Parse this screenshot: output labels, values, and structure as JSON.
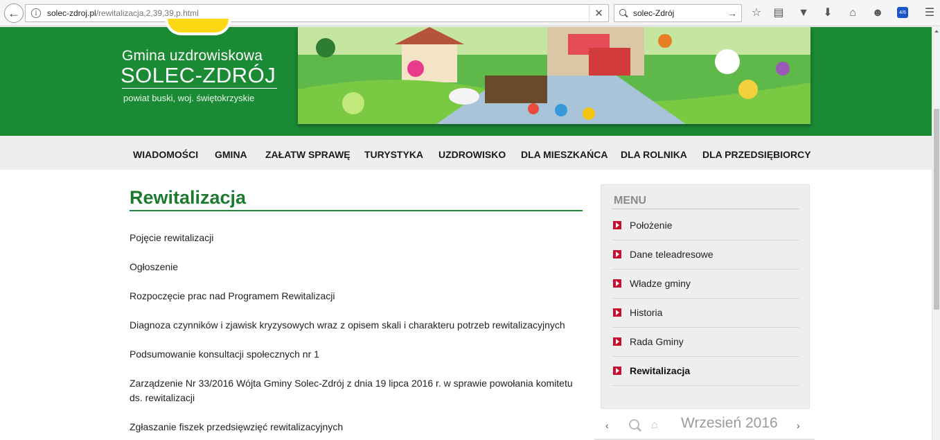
{
  "browser": {
    "url_domain": "solec-zdroj.pl",
    "url_path": "/rewitalizacja,2,39,39,p.html",
    "search_value": "solec-Zdrój",
    "tab_badge": "4/6"
  },
  "brand": {
    "line1": "Gmina uzdrowiskowa",
    "line2": "SOLEC-ZDRÓJ",
    "line3": "powiat buski, woj. świętokrzyskie"
  },
  "nav": {
    "items": [
      "WIADOMOŚCI",
      "GMINA",
      "ZAŁATW SPRAWĘ",
      "TURYSTYKA",
      "UZDROWISKO",
      "DLA MIESZKAŃCA",
      "DLA ROLNIKA",
      "DLA PRZEDSIĘBIORCY"
    ]
  },
  "main": {
    "title": "Rewitalizacja",
    "links": [
      "Pojęcie rewitalizacji",
      "Ogłoszenie",
      "Rozpoczęcie prac nad Programem Rewitalizacji",
      "Diagnoza czynników i zjawisk kryzysowych wraz z opisem skali i charakteru potrzeb rewitalizacyjnych",
      "Podsumowanie konsultacji społecznych nr 1",
      "Zarządzenie Nr 33/2016 Wójta Gminy Solec-Zdrój z dnia 19 lipca 2016 r. w sprawie powołania komitetu ds. rewitalizacji",
      "Zgłaszanie fiszek przedsięwzięć rewitalizacyjnych"
    ]
  },
  "sidebar": {
    "heading": "MENU",
    "items": [
      "Położenie",
      "Dane teleadresowe",
      "Władze gminy",
      "Historia",
      "Rada Gminy",
      "Rewitalizacja"
    ],
    "active_index": 5
  },
  "calendar": {
    "month": "Wrzesień 2016"
  },
  "colors": {
    "header_green": "#1b8a34",
    "title_green": "#1b7a2f",
    "bullet_red": "#c8102e"
  }
}
